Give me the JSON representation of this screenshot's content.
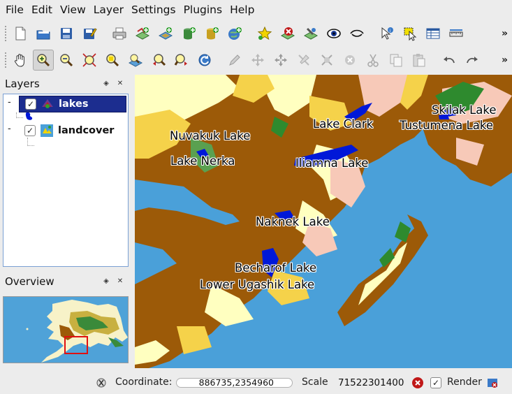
{
  "menu": [
    "File",
    "Edit",
    "View",
    "Layer",
    "Settings",
    "Plugins",
    "Help"
  ],
  "toolbar1": {
    "icons": [
      "new-project-icon",
      "open-project-icon",
      "save-project-icon",
      "save-as-icon",
      "print-icon",
      "add-vector-layer-icon",
      "add-raster-layer-icon",
      "add-postgis-layer-icon",
      "add-spatialite-layer-icon",
      "add-wms-layer-icon",
      "new-bookmark-icon",
      "remove-layer-icon",
      "layer-properties-icon",
      "show-all-layers-icon",
      "hide-all-layers-icon",
      "identify-icon",
      "select-features-icon",
      "attribute-table-icon",
      "measure-icon"
    ],
    "more": "»"
  },
  "toolbar2": {
    "icons": [
      "pan-icon",
      "zoom-in-icon",
      "zoom-out-icon",
      "zoom-full-icon",
      "zoom-selection-icon",
      "zoom-layer-icon",
      "zoom-last-icon",
      "zoom-next-icon",
      "refresh-icon",
      "toggle-editing-icon",
      "move-feature-icon",
      "node-tool-icon",
      "add-ring-icon",
      "delete-selected-icon",
      "delete-part-icon",
      "cut-features-icon",
      "copy-features-icon",
      "paste-features-icon",
      "undo-icon",
      "redo-icon"
    ],
    "more": "»"
  },
  "layers_panel": {
    "title": "Layers",
    "layers": [
      {
        "name": "lakes",
        "checked": true,
        "selected": true,
        "legend_color": "#0018d8"
      },
      {
        "name": "landcover",
        "checked": true,
        "selected": false
      }
    ]
  },
  "overview_panel": {
    "title": "Overview"
  },
  "map": {
    "labels": [
      {
        "text": "Skilak Lake"
      },
      {
        "text": "Lake Clark"
      },
      {
        "text": "Tustumena Lake"
      },
      {
        "text": "Nuvakuk Lake"
      },
      {
        "text": "Lake Nerka"
      },
      {
        "text": "Iliamna Lake"
      },
      {
        "text": "Naknek Lake"
      },
      {
        "text": "Becharof Lake"
      },
      {
        "text": "Lower Ugashik Lake"
      }
    ],
    "colors": {
      "water": "#4aa0d9",
      "land": "#9c5a08",
      "lakes": "#0018d8",
      "tundra": "#ffffc0",
      "scrub": "#f5d24a",
      "forest": "#2e8a2e",
      "barren": "#f7c9b8"
    }
  },
  "status": {
    "coordinate_label": "Coordinate:",
    "coordinate_value": "886735,2354960",
    "scale_label": "Scale",
    "scale_value": "71522301400",
    "render_label": "Render",
    "render_checked": true
  }
}
